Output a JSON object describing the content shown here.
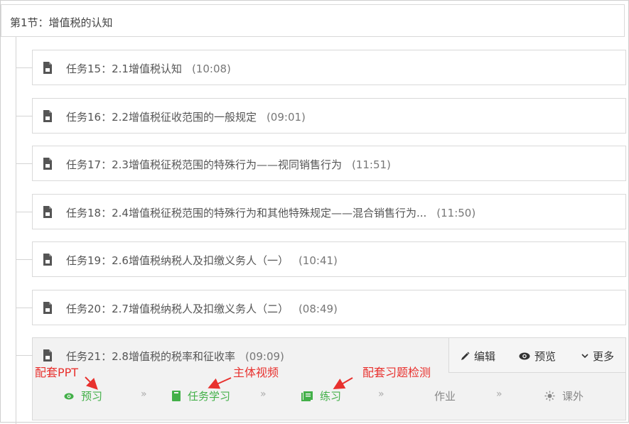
{
  "section": {
    "title": "第1节：增值税的认知"
  },
  "tasks": [
    {
      "label": "任务15：",
      "title": "2.1增值税认知",
      "duration": "(10:08)"
    },
    {
      "label": "任务16：",
      "title": "2.2增值税征收范围的一般规定",
      "duration": "(09:01)"
    },
    {
      "label": "任务17：",
      "title": "2.3增值税征税范围的特殊行为——视同销售行为",
      "duration": "(11:51)"
    },
    {
      "label": "任务18：",
      "title": "2.4增值税征税范围的特殊行为和其他特殊规定——混合销售行为...",
      "duration": "(11:50)"
    },
    {
      "label": "任务19：",
      "title": "2.6增值税纳税人及扣缴义务人（一）",
      "duration": "(10:41)"
    },
    {
      "label": "任务20：",
      "title": "2.7增值税纳税人及扣缴义务人（二）",
      "duration": "(08:49)"
    }
  ],
  "active_task": {
    "label": "任务21：",
    "title": "2.8增值税的税率和征收率",
    "duration": "(09:09)",
    "actions": {
      "edit": "编辑",
      "preview": "预览",
      "more": "更多"
    },
    "steps": {
      "preview": "预习",
      "task_learning": "任务学习",
      "practice": "练习",
      "homework": "作业",
      "extracurricular": "课外"
    },
    "chevron": "»"
  },
  "annotations": {
    "ppt": "配套PPT",
    "video": "主体视频",
    "quiz": "配套习题检测"
  },
  "colors": {
    "green": "#43b049",
    "annotation_red": "#e8312e",
    "border": "#d9d9d9"
  }
}
